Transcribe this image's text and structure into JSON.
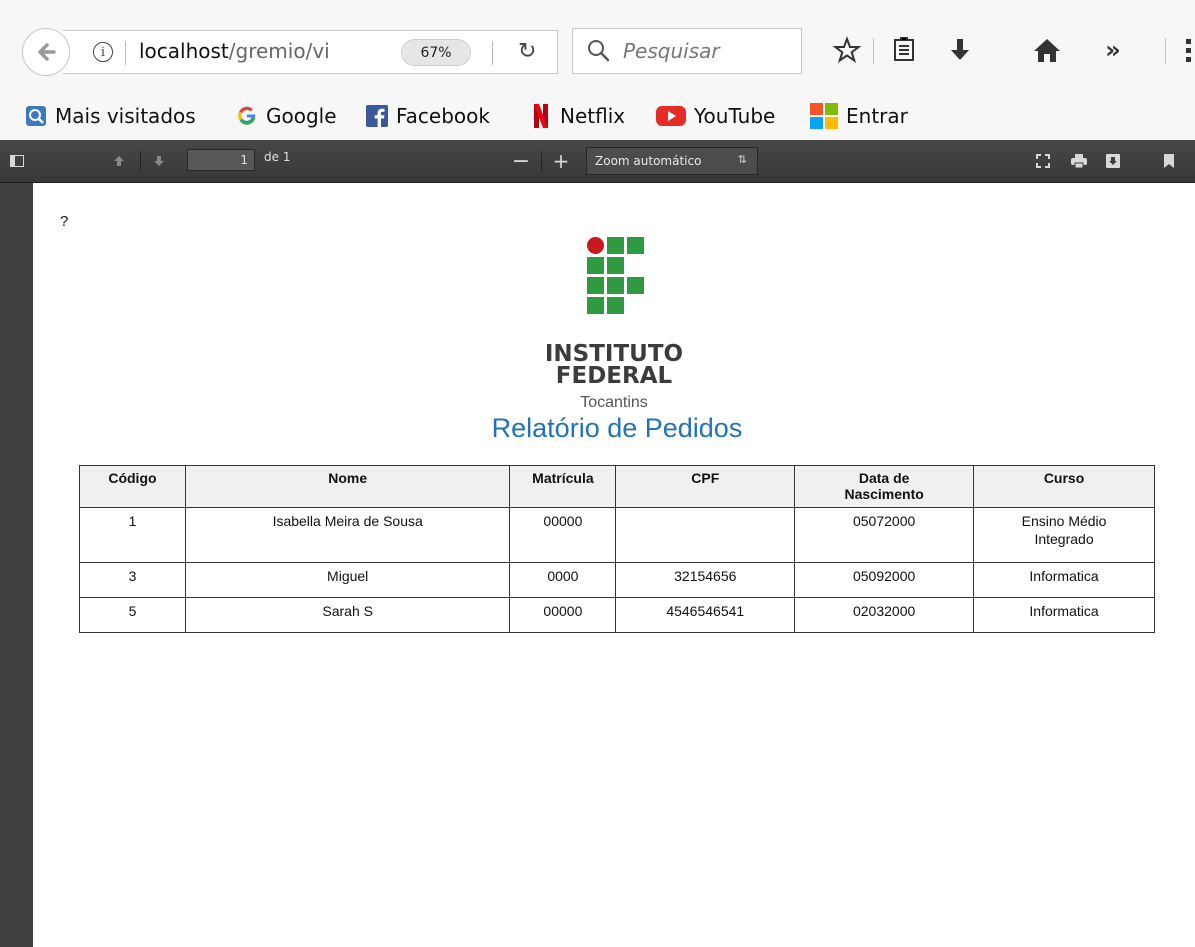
{
  "browser": {
    "url_host": "localhost",
    "url_path": "/gremio/vi",
    "zoom_level": "67%",
    "search_placeholder": "Pesquisar",
    "overflow_label": "»"
  },
  "bookmarks": [
    {
      "label": "Mais visitados",
      "icon": "most-visited-icon"
    },
    {
      "label": "Google",
      "icon": "google-icon"
    },
    {
      "label": "Facebook",
      "icon": "facebook-icon"
    },
    {
      "label": "Netflix",
      "icon": "netflix-icon"
    },
    {
      "label": "YouTube",
      "icon": "youtube-icon"
    },
    {
      "label": "Entrar",
      "icon": "microsoft-icon"
    }
  ],
  "pdf_viewer": {
    "page_number": "1",
    "page_total": "de 1",
    "zoom_option": "Zoom automático"
  },
  "document": {
    "top_mark": "?",
    "logo_line1": "INSTITUTO",
    "logo_line2": "FEDERAL",
    "logo_line3": "Tocantins",
    "title": "Relatório de Pedidos",
    "table": {
      "headers": [
        "Código",
        "Nome",
        "Matrícula",
        "CPF",
        "Data de Nascimento",
        "Curso"
      ],
      "rows": [
        [
          "1",
          "Isabella Meira de Sousa",
          "00000",
          "",
          "05072000",
          "Ensino Médio Integrado"
        ],
        [
          "3",
          "Miguel",
          "0000",
          "32154656",
          "05092000",
          "Informatica"
        ],
        [
          "5",
          "Sarah S",
          "00000",
          "4546546541",
          "02032000",
          "Informatica"
        ]
      ]
    }
  },
  "colors": {
    "logo_green": "#2f9a41",
    "logo_red": "#c8191e",
    "title_blue": "#2373b7",
    "pdf_toolbar": "#404040"
  }
}
